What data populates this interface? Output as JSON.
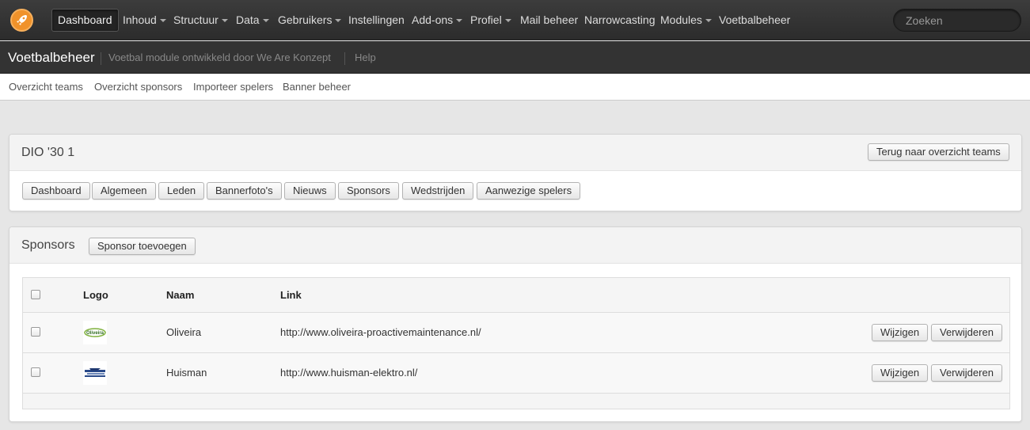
{
  "topnav": {
    "items": [
      {
        "label": "Dashboard",
        "dropdown": false,
        "active": true
      },
      {
        "label": "Inhoud",
        "dropdown": true
      },
      {
        "label": "Structuur",
        "dropdown": true
      },
      {
        "label": "Data",
        "dropdown": true
      },
      {
        "label": "Gebruikers",
        "dropdown": true
      },
      {
        "label": "Instellingen",
        "dropdown": false
      },
      {
        "label": "Add-ons",
        "dropdown": true
      },
      {
        "label": "Profiel",
        "dropdown": true
      },
      {
        "label": "Mail beheer",
        "dropdown": false
      },
      {
        "label": "Narrowcasting",
        "dropdown": false
      },
      {
        "label": "Modules",
        "dropdown": true
      },
      {
        "label": "Voetbalbeheer",
        "dropdown": false
      }
    ],
    "search_placeholder": "Zoeken",
    "logo_icon": "rocket-icon",
    "accent": "#f0922a"
  },
  "module": {
    "title": "Voetbalbeheer",
    "description": "Voetbal module ontwikkeld door We Are Konzept",
    "help": "Help"
  },
  "subnav": [
    "Overzicht teams",
    "Overzicht sponsors",
    "Importeer spelers",
    "Banner beheer"
  ],
  "team_panel": {
    "title": "DIO '30 1",
    "back_button": "Terug naar overzicht teams",
    "tabs": [
      "Dashboard",
      "Algemeen",
      "Leden",
      "Bannerfoto's",
      "Nieuws",
      "Sponsors",
      "Wedstrijden",
      "Aanwezige spelers"
    ]
  },
  "sponsors_panel": {
    "title": "Sponsors",
    "add_button": "Sponsor toevoegen",
    "columns": {
      "logo": "Logo",
      "name": "Naam",
      "link": "Link"
    },
    "rows": [
      {
        "name": "Oliveira",
        "link": "http://www.oliveira-proactivemaintenance.nl/",
        "logo_text": "Oliveira",
        "edit": "Wijzigen",
        "delete": "Verwijderen"
      },
      {
        "name": "Huisman",
        "link": "http://www.huisman-elektro.nl/",
        "logo_text": "",
        "edit": "Wijzigen",
        "delete": "Verwijderen"
      }
    ]
  }
}
